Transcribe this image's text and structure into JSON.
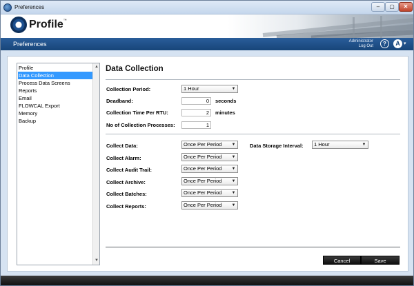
{
  "window": {
    "title": "Preferences",
    "controls": [
      "–",
      "▢",
      "✕"
    ]
  },
  "header": {
    "logo_text": "Profile",
    "logo_tm": "™"
  },
  "navbar": {
    "title": "Preferences",
    "user": "Administrator",
    "logout": "Log Out",
    "help": "?",
    "lang": "A",
    "lang_caret": "▾"
  },
  "sidebar": {
    "items": [
      {
        "label": "Profile",
        "selected": false
      },
      {
        "label": "Data Collection",
        "selected": true
      },
      {
        "label": "Process Data Screens",
        "selected": false
      },
      {
        "label": "Reports",
        "selected": false
      },
      {
        "label": "Email",
        "selected": false
      },
      {
        "label": "FLOWCAL Export",
        "selected": false
      },
      {
        "label": "Memory",
        "selected": false
      },
      {
        "label": "Backup",
        "selected": false
      }
    ],
    "scroll_up": "▲",
    "scroll_down": "▼"
  },
  "form": {
    "title": "Data Collection",
    "collection_period": {
      "label": "Collection Period:",
      "value": "1 Hour"
    },
    "deadband": {
      "label": "Deadband:",
      "value": "0",
      "unit": "seconds"
    },
    "collection_time": {
      "label": "Collection Time Per RTU:",
      "value": "2",
      "unit": "minutes"
    },
    "processes": {
      "label": "No of Collection Processes:",
      "value": "1"
    },
    "collect_data": {
      "label": "Collect Data:",
      "value": "Once Per Period"
    },
    "storage_interval": {
      "label": "Data Storage Interval:",
      "value": "1 Hour"
    },
    "collect_alarm": {
      "label": "Collect Alarm:",
      "value": "Once Per Period"
    },
    "collect_audit": {
      "label": "Collect Audit Trail:",
      "value": "Once Per Period"
    },
    "collect_archive": {
      "label": "Collect Archive:",
      "value": "Once Per Period"
    },
    "collect_batches": {
      "label": "Collect Batches:",
      "value": "Once Per Period"
    },
    "collect_reports": {
      "label": "Collect Reports:",
      "value": "Once Per Period"
    },
    "caret": "▼"
  },
  "buttons": {
    "cancel": "Cancel",
    "save": "Save"
  },
  "colors": {
    "navbar": "#1f5189",
    "selection": "#3399ff",
    "button": "#1a1a1a"
  }
}
